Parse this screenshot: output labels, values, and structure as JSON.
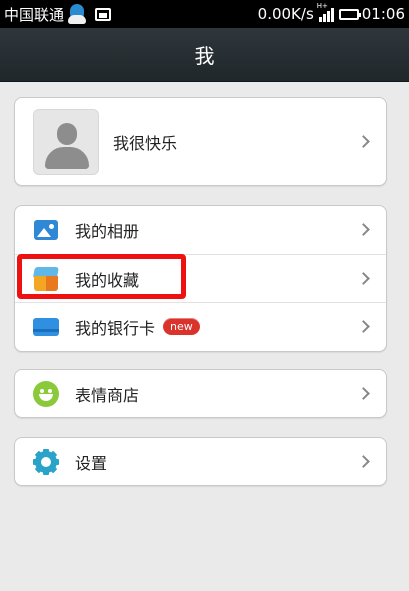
{
  "status_bar": {
    "carrier": "中国联通",
    "speed": "0.00K/s",
    "network_type": "H+",
    "time": "01:06"
  },
  "header": {
    "title": "我"
  },
  "profile": {
    "name": "我很快乐"
  },
  "menu_group": [
    {
      "label": "我的相册",
      "icon": "album-icon"
    },
    {
      "label": "我的收藏",
      "icon": "favorites-box-icon"
    },
    {
      "label": "我的银行卡",
      "icon": "bank-card-icon",
      "badge": "new"
    }
  ],
  "sticker_store": {
    "label": "表情商店",
    "icon": "smiley-icon"
  },
  "settings": {
    "label": "设置",
    "icon": "gear-icon"
  },
  "annotation": {
    "color": "#ee1111",
    "target": "我的收藏"
  },
  "colors": {
    "title_bar": "#263035",
    "background": "#eaeaea",
    "badge": "#d9332b"
  }
}
